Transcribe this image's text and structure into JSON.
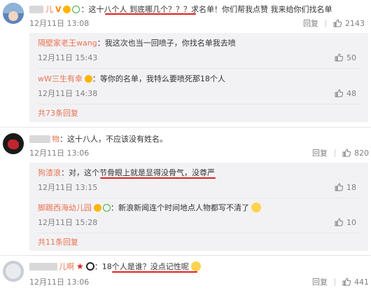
{
  "comments": [
    {
      "user": "儿",
      "text": "这十八个人 到底哪几个？？？求名单！你们帮我点赞 我来给你们找名单",
      "time": "12月11日 13:08",
      "reply": "回复",
      "likes": "2143",
      "replies": [
        {
          "user": "隔壁家老王wang",
          "text": "：我这次也当一回喷子，你找名单我去喷",
          "time": "12月11日 15:43",
          "likes": "50"
        },
        {
          "user": "wW三生有幸",
          "text": "：等你的名单，我特么要喷死那18个人",
          "time": "12月11日 14:38",
          "likes": "48"
        }
      ],
      "more": "共73条回复"
    },
    {
      "user": "物",
      "text": "：这十八人，不应该没有姓名。",
      "time": "12月11日 13:06",
      "reply": "回复",
      "likes": "820",
      "replies": [
        {
          "user": "狗渣浪",
          "text": "：对，这个节骨眼上就是显得没骨气，没尊严",
          "time": "12月11日 13:15",
          "likes": "18"
        },
        {
          "user": "脚踢西海幼儿园",
          "text": "：新浪新闻连个时间地点人物都写不清了",
          "time": "12月11日 15:28",
          "likes": "10"
        }
      ],
      "more": "共11条回复"
    },
    {
      "user": "儿啊",
      "text": "：18个人是谁？没点记性呢",
      "time": "12月11日 13:06",
      "reply": "回复",
      "likes": "441"
    }
  ],
  "icons": {
    "like": "thumbs-up-icon",
    "verified": "verified-icon",
    "vip": "vip-icon"
  },
  "colors": {
    "username": "#eb7350",
    "highlight": "#e02020",
    "subbox": "#f2f2f5"
  }
}
